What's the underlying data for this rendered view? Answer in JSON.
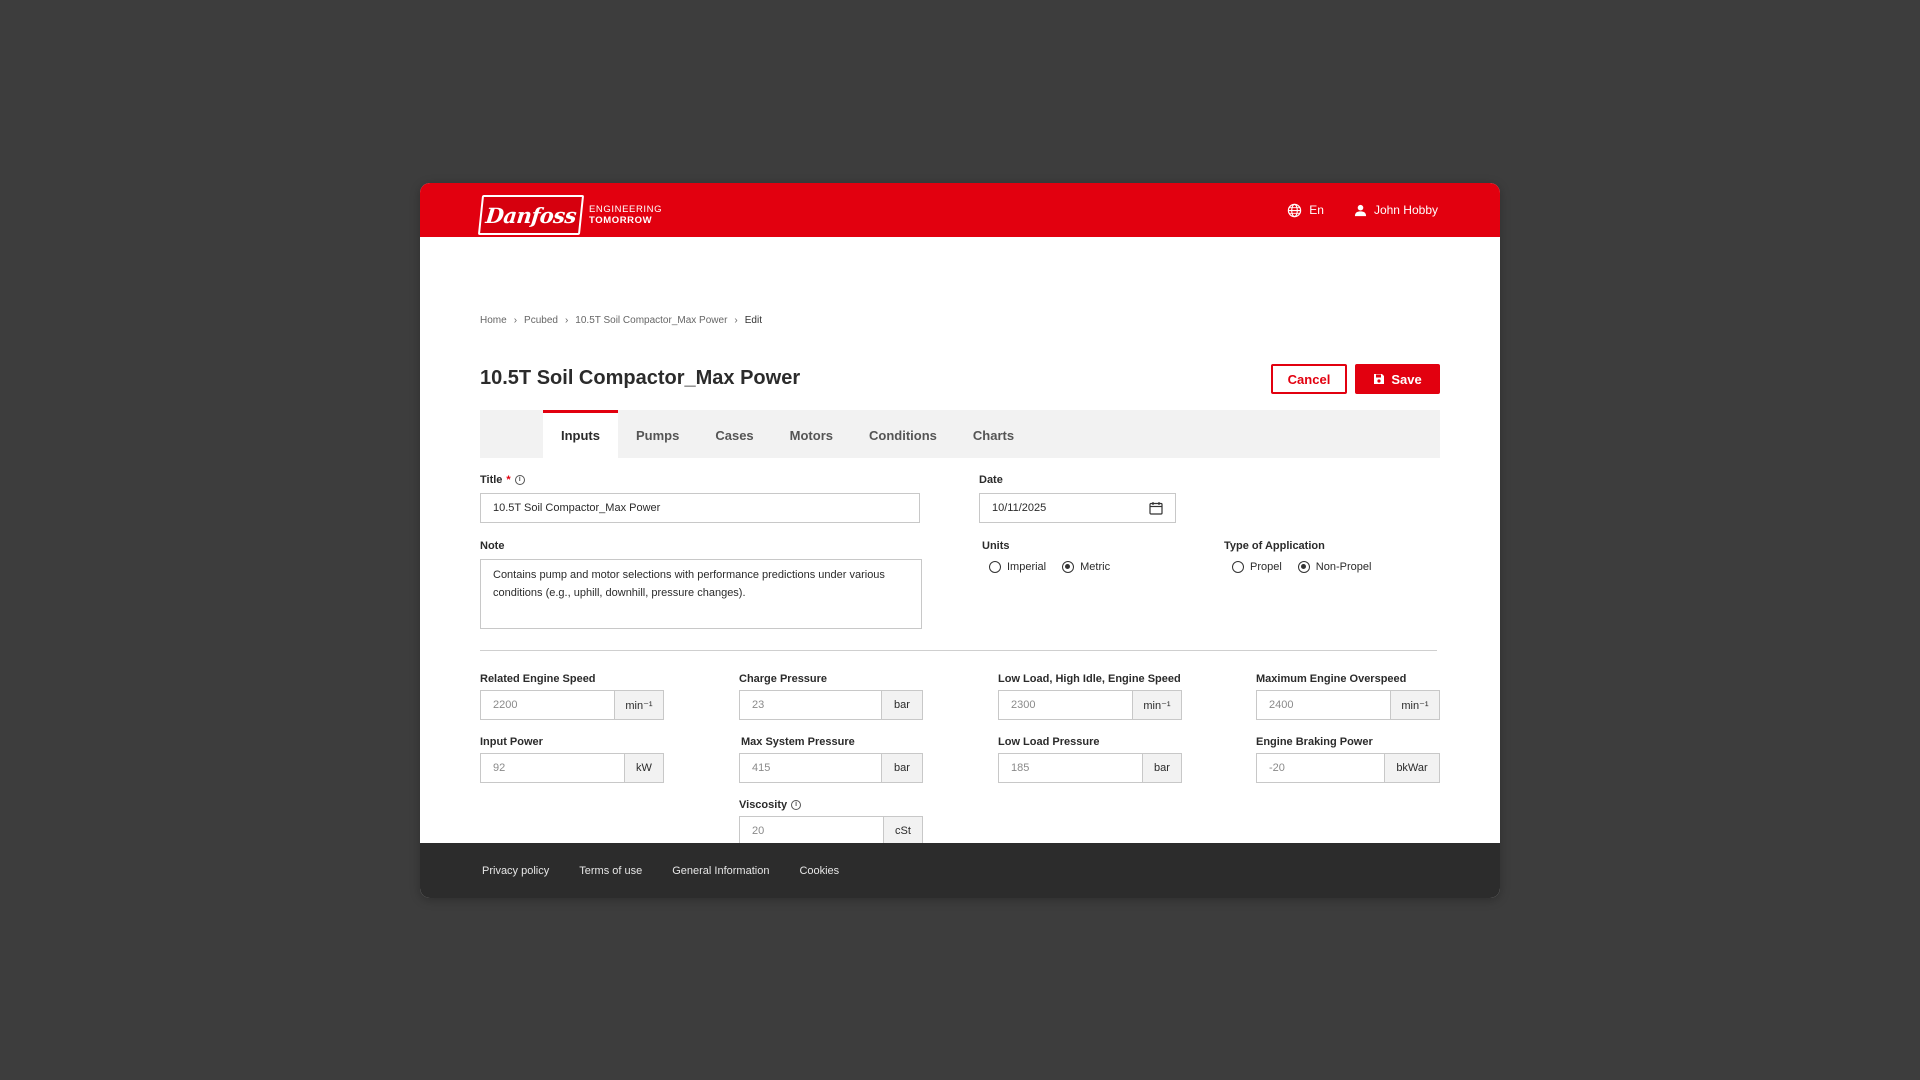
{
  "header": {
    "logo_text": "Danfoss",
    "tagline_line1": "ENGINEERING",
    "tagline_line2": "TOMORROW",
    "language": "En",
    "user": "John Hobby",
    "brand_color": "#e2000f"
  },
  "breadcrumb": [
    "Home",
    "Pcubed",
    "10.5T Soil Compactor_Max Power",
    "Edit"
  ],
  "page": {
    "title": "10.5T Soil Compactor_Max Power",
    "cancel_label": "Cancel",
    "save_label": "Save"
  },
  "tabs": [
    {
      "label": "Inputs",
      "active": true
    },
    {
      "label": "Pumps",
      "active": false
    },
    {
      "label": "Cases",
      "active": false
    },
    {
      "label": "Motors",
      "active": false
    },
    {
      "label": "Conditions",
      "active": false
    },
    {
      "label": "Charts",
      "active": false
    }
  ],
  "form": {
    "title_label": "Title",
    "title_required": "*",
    "title_value": "10.5T Soil Compactor_Max Power",
    "date_label": "Date",
    "date_value": "10/11/2025",
    "note_label": "Note",
    "note_value": "Contains pump and motor selections with performance predictions under various conditions (e.g., uphill, downhill, pressure changes).",
    "units_label": "Units",
    "units_options": [
      "Imperial",
      "Metric"
    ],
    "units_selected": "Metric",
    "application_label": "Type of Application",
    "application_options": [
      "Propel",
      "Non-Propel"
    ],
    "application_selected": "Non-Propel"
  },
  "parameters": {
    "related_engine_speed": {
      "label": "Related Engine Speed",
      "value": "2200",
      "unit": "min⁻¹"
    },
    "input_power": {
      "label": "Input Power",
      "value": "92",
      "unit": "kW"
    },
    "charge_pressure": {
      "label": "Charge Pressure",
      "value": "23",
      "unit": "bar"
    },
    "max_system_pressure": {
      "label": "Max System Pressure",
      "value": "415",
      "unit": "bar"
    },
    "viscosity": {
      "label": "Viscosity",
      "value": "20",
      "unit": "cSt"
    },
    "low_load_high_idle": {
      "label": "Low Load, High Idle, Engine Speed",
      "value": "2300",
      "unit": "min⁻¹"
    },
    "low_load_pressure": {
      "label": "Low Load Pressure",
      "value": "185",
      "unit": "bar"
    },
    "max_engine_overspeed": {
      "label": "Maximum Engine Overspeed",
      "value": "2400",
      "unit": "min⁻¹"
    },
    "engine_braking_power": {
      "label": "Engine Braking Power",
      "value": "-20",
      "unit": "bkWar"
    }
  },
  "footer": [
    "Privacy policy",
    "Terms of use",
    "General Information",
    "Cookies"
  ]
}
